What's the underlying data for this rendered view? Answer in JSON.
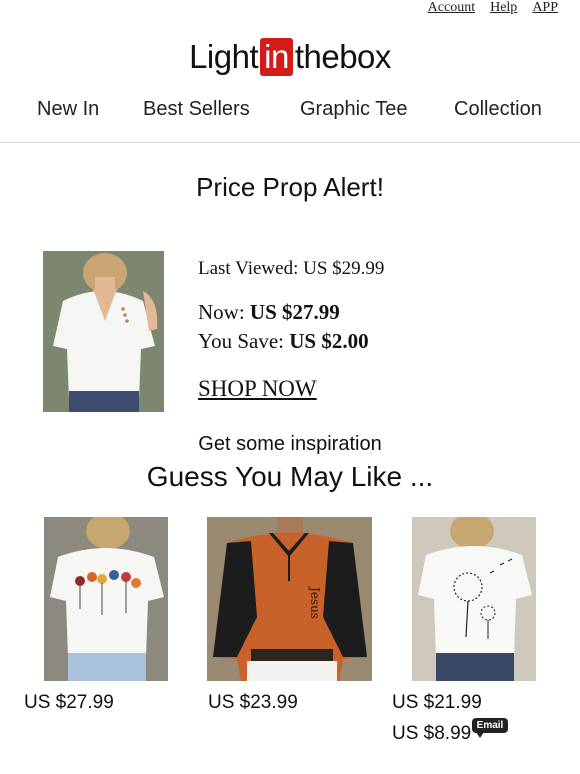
{
  "top_links": [
    "Account",
    "Help",
    "APP"
  ],
  "logo": {
    "part1": "Light",
    "part2": "in",
    "part3": "thebox"
  },
  "nav": [
    "New In",
    "Best Sellers",
    "Graphic Tee",
    "Collection"
  ],
  "headline": "Price Prop Alert!",
  "product": {
    "last_viewed_label": "Last Viewed: ",
    "last_viewed_price": "US $29.99",
    "now_label": "Now: ",
    "now_price": "US $27.99",
    "save_label": "You Save: ",
    "save_amount": "US $2.00",
    "cta": "SHOP NOW"
  },
  "inspiration": "Get some inspiration",
  "guess": "Guess You May Like ...",
  "recommendations": [
    {
      "price": "US $27.99"
    },
    {
      "price": "US $23.99"
    },
    {
      "price": "US $21.99",
      "extra_price": "US $8.99"
    }
  ],
  "badge": "Email",
  "colors": {
    "brand_red": "#d21b1b",
    "shirt_orange": "#c8612a"
  }
}
